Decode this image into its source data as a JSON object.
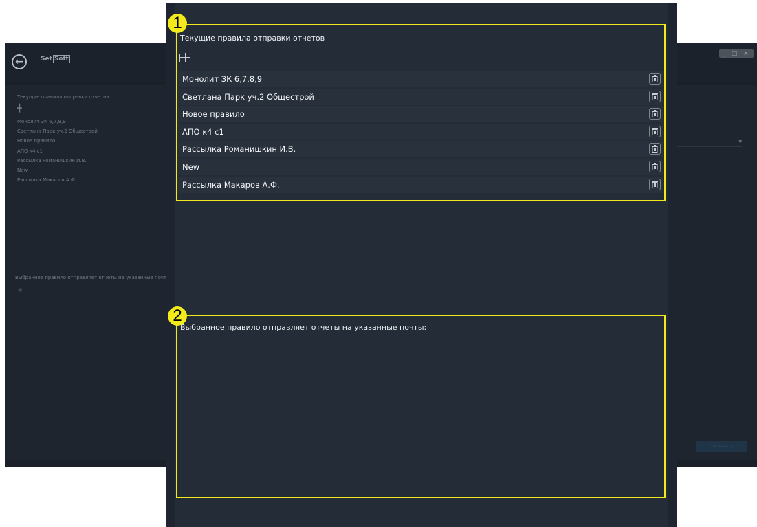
{
  "background_window": {
    "logo_text": "Set",
    "logo_boxed": "Soft",
    "window_controls": "_ □ ×",
    "rules_title": "Текущие правила отправки отчетов",
    "rules": [
      "Монолит ЗК 6,7,8,9",
      "Светлана Парк уч.2 Общестрой",
      "Новое правило",
      "АПО к4 с1",
      "Рассылка Романишкин И.В.",
      "New",
      "Рассылка Макаров А.Ф."
    ],
    "emails_title": "Выбранное правило отправляет отчеты на указанные почты:",
    "save_label": "Сохранить"
  },
  "dialog": {
    "callouts": [
      "1",
      "2"
    ],
    "rules_title": "Текущие правила отправки отчетов",
    "rules": [
      {
        "label": "Монолит ЗК 6,7,8,9"
      },
      {
        "label": "Светлана Парк уч.2 Общестрой"
      },
      {
        "label": "Новое правило"
      },
      {
        "label": "АПО к4 с1"
      },
      {
        "label": "Рассылка Романишкин И.В."
      },
      {
        "label": "New"
      },
      {
        "label": "Рассылка Макаров А.Ф."
      }
    ],
    "emails_title": "Выбранное правило отправляет отчеты на указанные почты:"
  },
  "icons": {
    "back": "arrow-left-circle-icon",
    "add": "plus-icon",
    "delete": "trash-icon"
  },
  "colors": {
    "highlight": "#f2ea1a",
    "dialog_bg": "#242c38",
    "text": "#f3f5f7"
  }
}
